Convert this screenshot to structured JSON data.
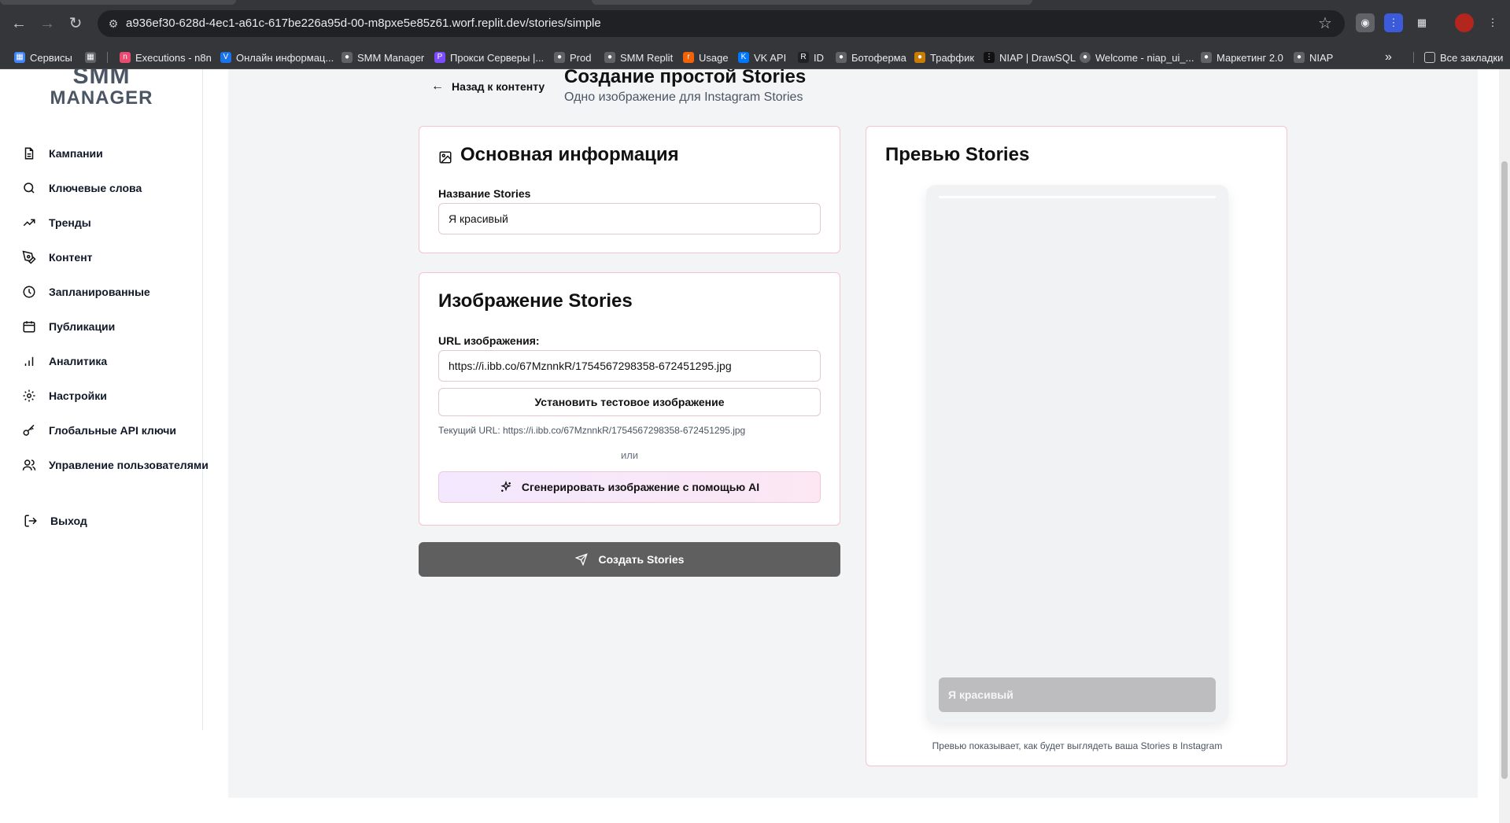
{
  "browser": {
    "url": "a936ef30-628d-4ec1-a61c-617be226a95d-00-m8pxe5e85z61.worf.replit.dev/stories/simple",
    "nav_icons": [
      "back-arrow-icon",
      "forward-arrow-icon",
      "reload-icon"
    ],
    "bookmarks": [
      {
        "label": "Сервисы",
        "icon": "apps-grid-icon",
        "color": "#4285f4"
      },
      {
        "label": "Executions - n8n",
        "icon": "n8n-icon",
        "color": "#ea4b71"
      },
      {
        "label": "Онлайн информац...",
        "icon": "v-icon",
        "color": "#8ab4f8"
      },
      {
        "label": "SMM Manager",
        "icon": "globe-icon",
        "color": "#9aa0a6"
      },
      {
        "label": "Прокси Серверы |...",
        "icon": "proxy-icon",
        "color": "#7c4dff"
      },
      {
        "label": "Prod",
        "icon": "globe-icon",
        "color": "#9aa0a6"
      },
      {
        "label": "SMM Replit",
        "icon": "globe-icon",
        "color": "#9aa0a6"
      },
      {
        "label": "Usage",
        "icon": "replit-icon",
        "color": "#f26207"
      },
      {
        "label": "VK API",
        "icon": "vk-icon",
        "color": "#0077ff"
      },
      {
        "label": "ID",
        "icon": "r-icon",
        "color": "#ffffff"
      },
      {
        "label": "Ботоферма",
        "icon": "globe-icon",
        "color": "#9aa0a6"
      },
      {
        "label": "Траффик",
        "icon": "traffic-icon",
        "color": "#f4b400"
      },
      {
        "label": "NIAP | DrawSQL",
        "icon": "drawsql-icon",
        "color": "#202124"
      },
      {
        "label": "Welcome - niap_ui_...",
        "icon": "github-icon",
        "color": "#ffffff"
      },
      {
        "label": "Маркетинг 2.0",
        "icon": "globe-icon",
        "color": "#9aa0a6"
      },
      {
        "label": "NIAP",
        "icon": "globe-icon",
        "color": "#9aa0a6"
      }
    ],
    "all_bookmarks": "Все закладки"
  },
  "sidebar": {
    "logo_line1": "SMM",
    "logo_line2": "MANAGER",
    "items": [
      {
        "label": "Кампании",
        "icon": "document-icon"
      },
      {
        "label": "Ключевые слова",
        "icon": "search-icon"
      },
      {
        "label": "Тренды",
        "icon": "trending-up-icon"
      },
      {
        "label": "Контент",
        "icon": "pen-tool-icon"
      },
      {
        "label": "Запланированные",
        "icon": "clock-icon"
      },
      {
        "label": "Публикации",
        "icon": "calendar-icon"
      },
      {
        "label": "Аналитика",
        "icon": "bar-chart-icon"
      },
      {
        "label": "Настройки",
        "icon": "gear-icon"
      },
      {
        "label": "Глобальные API ключи",
        "icon": "key-icon"
      },
      {
        "label": "Управление пользователями",
        "icon": "users-icon"
      }
    ],
    "logout": "Выход"
  },
  "header": {
    "back_label": "Назад к контенту",
    "title": "Создание простой Stories",
    "subtitle": "Одно изображение для Instagram Stories"
  },
  "basic_info": {
    "title": "Основная информация",
    "name_label": "Название Stories",
    "name_value": "Я красивый"
  },
  "image_card": {
    "title": "Изображение Stories",
    "url_label": "URL изображения:",
    "url_value": "https://i.ibb.co/67MznnkR/1754567298358-672451295.jpg",
    "test_button": "Установить тестовое изображение",
    "current_url": "Текущий URL: https://i.ibb.co/67MznnkR/1754567298358-672451295.jpg",
    "or": "или",
    "ai_button": "Сгенерировать изображение с помощью AI"
  },
  "create_button": "Создать Stories",
  "preview": {
    "title": "Превью Stories",
    "caption": "Я красивый",
    "note": "Превью показывает, как будет выглядеть ваша Stories в Instagram"
  },
  "colors": {
    "card_border": "#f3c4cf",
    "create_button_bg": "#5f5f5f",
    "page_bg": "#f3f4f6"
  }
}
